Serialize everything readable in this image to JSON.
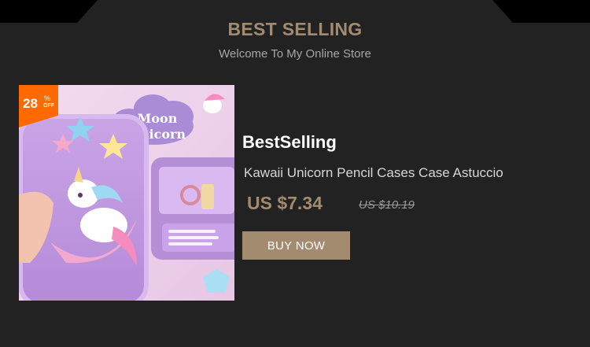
{
  "section": {
    "title": "BEST SELLING",
    "subtitle": "Welcome To My Online Store"
  },
  "product": {
    "image_icon": "unicorn-pencil-case-photo",
    "image_text_1": "Moon",
    "image_text_2": "Unicorn",
    "discount": {
      "value": "28",
      "percent": "%",
      "off": "OFF"
    },
    "brand": "BestSelling",
    "title": "Kawaii Unicorn Pencil Cases Case Astuccio",
    "price_current": "US $7.34",
    "price_original": "US $10.19",
    "buy_label": "BUY NOW"
  },
  "colors": {
    "background": "#222222",
    "accent": "#a38b70",
    "badge": "#ff6a00"
  }
}
